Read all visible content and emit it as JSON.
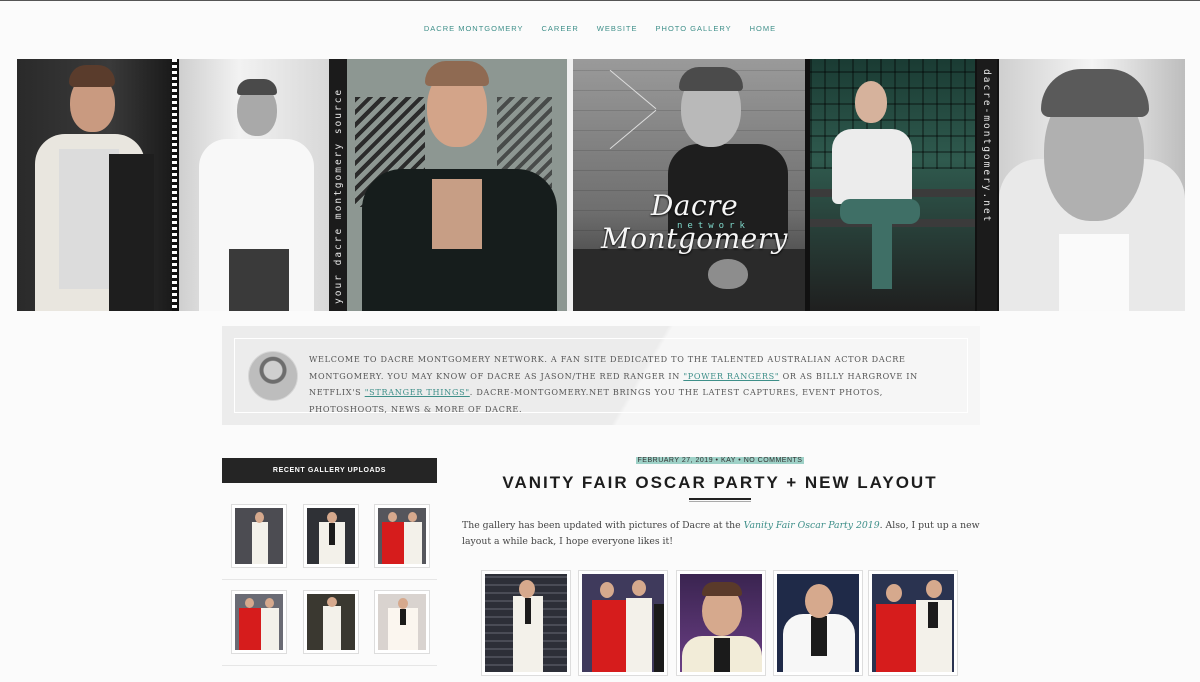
{
  "nav": {
    "items": [
      "DACRE MONTGOMERY",
      "CAREER",
      "WEBSITE",
      "PHOTO GALLERY",
      "HOME"
    ]
  },
  "banner": {
    "brand_title": "Dacre Montgomery",
    "brand_sub": "network",
    "vertical_left": "your dacre montgomery source",
    "vertical_right": "dacre-montgomery.net"
  },
  "welcome": {
    "text_1": "Welcome to Dacre Montgomery Network. A fan site dedicated to the talented Australian actor Dacre Montgomery. You may know of Dacre as Jason/The Red Ranger in ",
    "link_1": "\"Power Rangers\"",
    "text_2": " or as Billy Hargrove in Netflix's ",
    "link_2": "\"Stranger Things\"",
    "text_3": ". Dacre-Montgomery.net brings you the latest captures, event photos, photoshoots, news & more of Dacre."
  },
  "sidebar": {
    "heading": "RECENT GALLERY UPLOADS"
  },
  "post": {
    "date": "FEBRUARY 27, 2019",
    "author": "KAY",
    "comments": "NO COMMENTS",
    "dot": "•",
    "title": "VANITY FAIR OSCAR PARTY + NEW LAYOUT",
    "body_1": "The gallery has been updated with pictures of Dacre at the ",
    "body_link": "Vanity Fair Oscar Party 2019",
    "body_2": ". Also, I put up a new layout a while back, I hope everyone likes it!"
  },
  "colors": {
    "accent": "#3e8f89",
    "highlight": "#9ed1c7",
    "dark": "#252525"
  }
}
